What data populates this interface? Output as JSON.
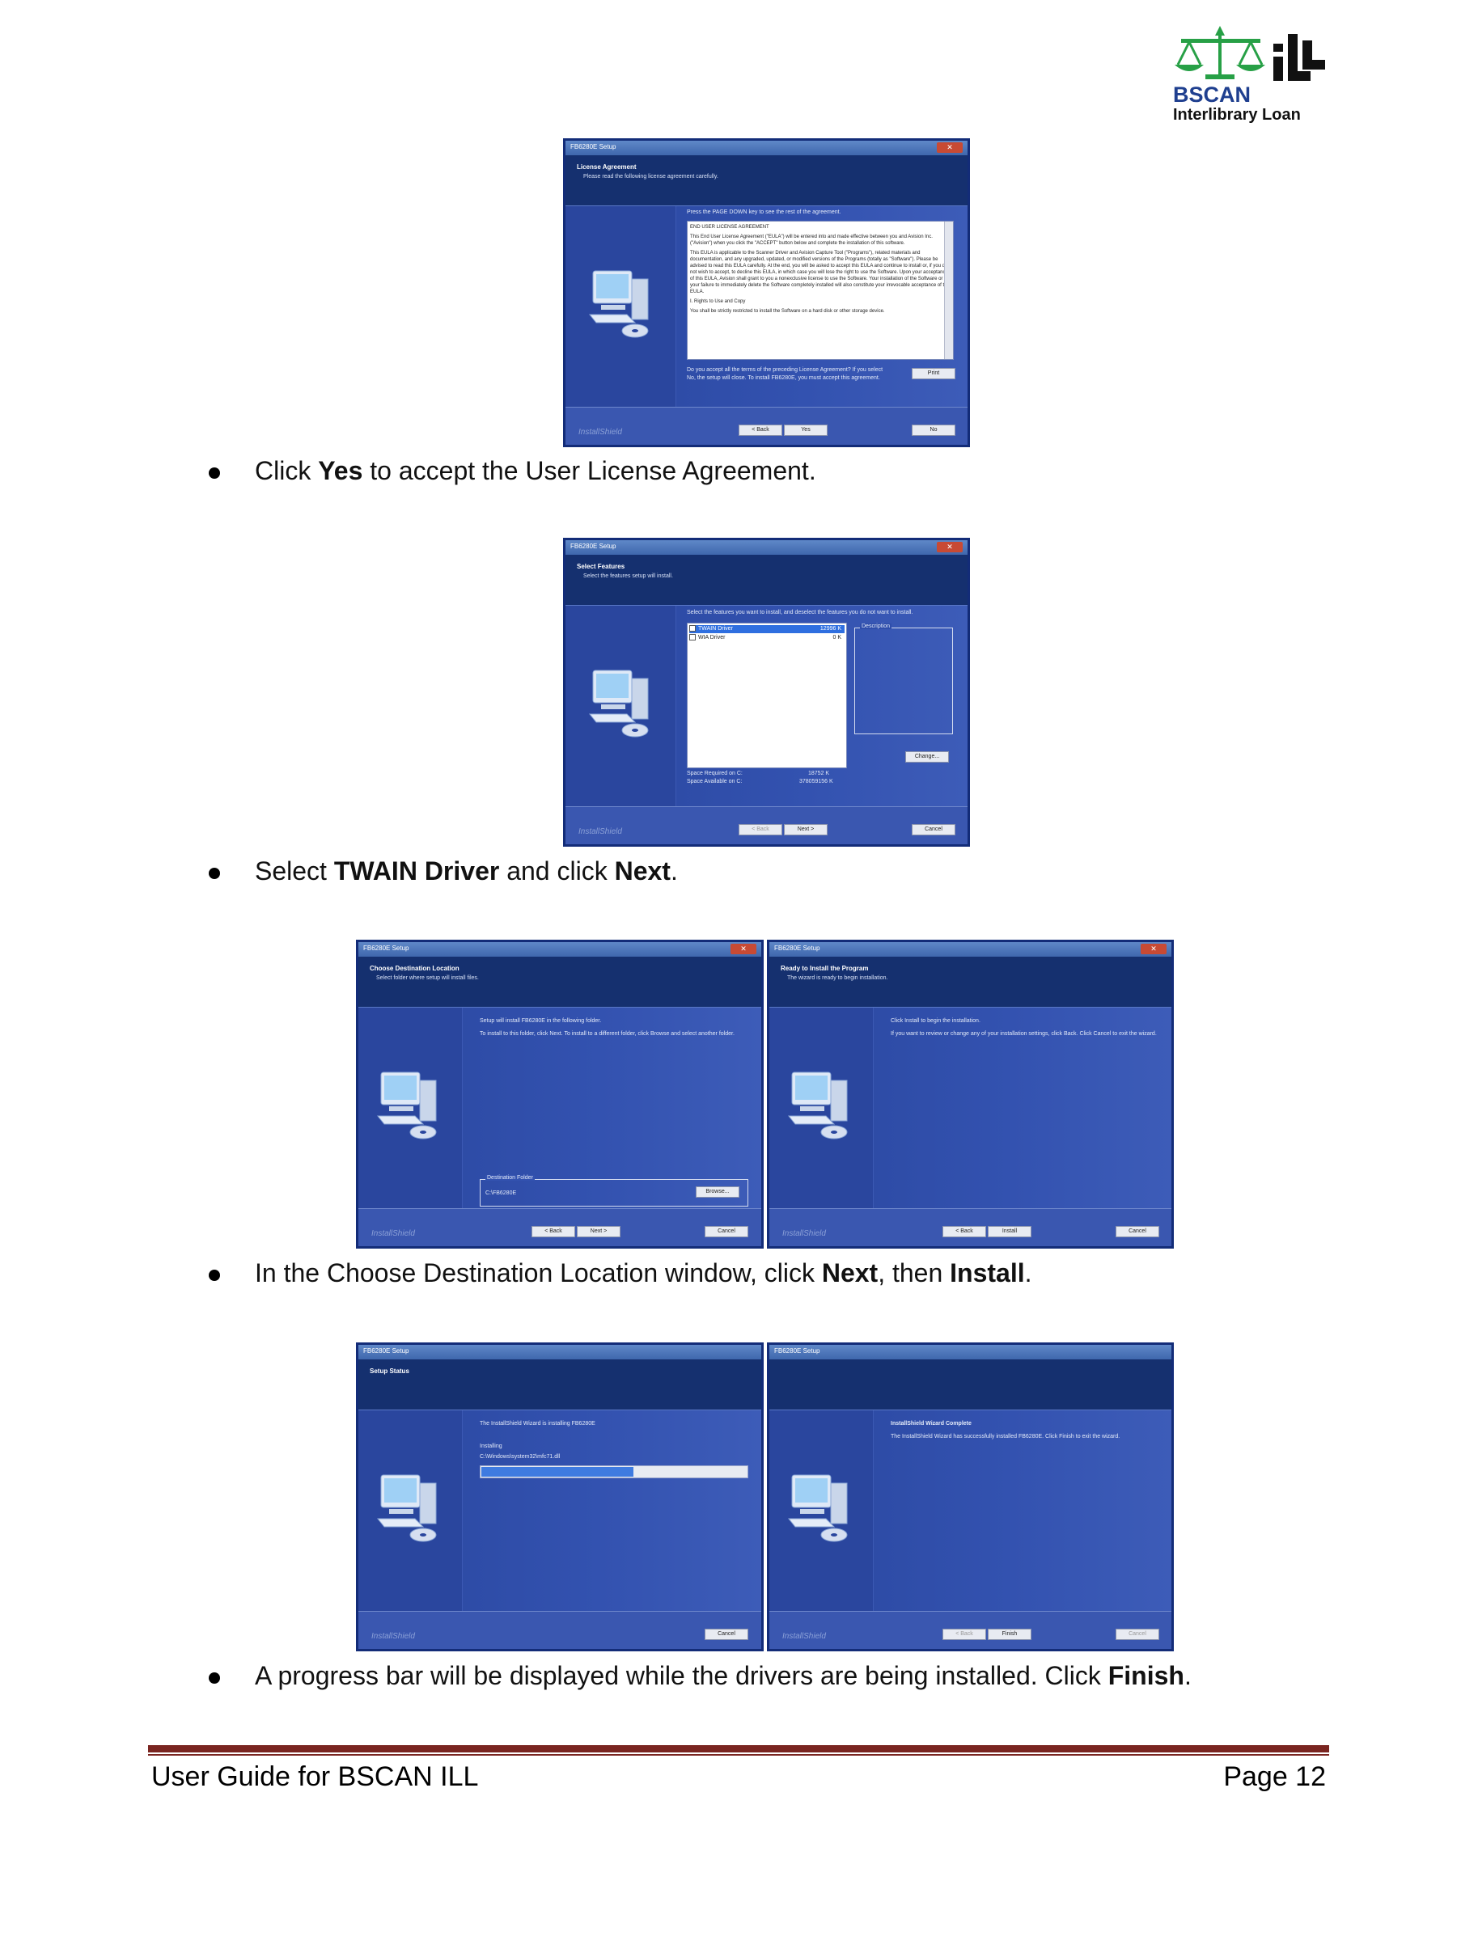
{
  "logo": {
    "brand": "BSCAN",
    "subtitle": "Interlibrary Loan",
    "mark": "ILL"
  },
  "screens": {
    "license": {
      "window_title": "FB6280E Setup",
      "header_title": "License Agreement",
      "header_sub": "Please read the following license agreement carefully.",
      "instruction": "Press the PAGE DOWN key to see the rest of the agreement.",
      "eula_heading": "END USER LICENSE AGREEMENT",
      "eula_p1": "This End User License Agreement (\"EULA\") will be entered into and made effective between you and Avision Inc. (\"Avision\") when you click the \"ACCEPT\" button below and complete the installation of this software.",
      "eula_p2": "This EULA is applicable to the Scanner Driver and Avision Capture Tool (\"Programs\"), related materials and documentation, and any upgraded, updated, or modified versions of the Programs (totally as \"Software\"). Please be advised to read this EULA carefully. At the end, you will be asked to accept this EULA and continue to install or, if you do not wish to accept, to decline this EULA, in which case you will lose the right to use the Software. Upon your acceptance of this EULA, Avision shall grant to you a nonexclusive license to use the Software. Your installation of the Software or your failure to immediately delete the Software completely installed will also constitute your irrevocable acceptance of this EULA.",
      "eula_p3": "I. Rights to Use and Copy",
      "eula_p4": "You shall be strictly restricted to install the Software on a hard disk or other storage device.",
      "question": "Do you accept all the terms of the preceding License Agreement? If you select No, the setup will close. To install FB6280E, you must accept this agreement.",
      "print": "Print",
      "back": "< Back",
      "yes": "Yes",
      "no": "No"
    },
    "features": {
      "window_title": "FB6280E Setup",
      "header_title": "Select Features",
      "header_sub": "Select the features setup will install.",
      "instruction": "Select the features you want to install, and deselect the features you do not want to install.",
      "items": [
        {
          "name": "TWAIN Driver",
          "size": "12996 K",
          "checked": true
        },
        {
          "name": "WIA Driver",
          "size": "0 K",
          "checked": false
        }
      ],
      "description_label": "Description",
      "change": "Change...",
      "space_required": "Space Required on  C:",
      "space_required_val": "18752 K",
      "space_available": "Space Available on  C:",
      "space_available_val": "378059156 K",
      "back": "< Back",
      "next": "Next >",
      "cancel": "Cancel"
    },
    "destination": {
      "window_title": "FB6280E Setup",
      "header_title": "Choose Destination Location",
      "header_sub": "Select folder where setup will install files.",
      "line1": "Setup will install FB6280E in the following folder.",
      "line2": "To install to this folder, click Next. To install to a different folder, click Browse and select another folder.",
      "folder_label": "Destination Folder",
      "folder_path": "C:\\FB6280E",
      "browse": "Browse...",
      "back": "< Back",
      "next": "Next >",
      "cancel": "Cancel"
    },
    "ready": {
      "window_title": "FB6280E Setup",
      "header_title": "Ready to Install the Program",
      "header_sub": "The wizard is ready to begin installation.",
      "line1": "Click Install to begin the installation.",
      "line2": "If you want to review or change any of your installation settings, click Back. Click Cancel to exit the wizard.",
      "back": "< Back",
      "install": "Install",
      "cancel": "Cancel"
    },
    "status": {
      "window_title": "FB6280E Setup",
      "header_title": "Setup Status",
      "line1": "The InstallShield Wizard is installing FB6280E",
      "installing": "Installing",
      "file": "C:\\Windows\\system32\\mfc71.dll",
      "progress": 0.57,
      "cancel": "Cancel"
    },
    "complete": {
      "window_title": "FB6280E Setup",
      "title": "InstallShield Wizard Complete",
      "line1": "The InstallShield Wizard has successfully installed FB6280E.  Click Finish to exit the wizard.",
      "back": "< Back",
      "finish": "Finish",
      "cancel": "Cancel"
    },
    "installshield": "InstallShield"
  },
  "bullets": {
    "b1": {
      "pre": "Click ",
      "bold": "Yes",
      "post": " to accept the User License Agreement."
    },
    "b2": {
      "pre": "Select ",
      "bold1": "TWAIN Driver",
      "mid": " and click ",
      "bold2": "Next",
      "post": "."
    },
    "b3": {
      "pre": "In the Choose Destination Location window, click ",
      "bold1": "Next",
      "mid": ", then ",
      "bold2": "Install",
      "post": "."
    },
    "b4": {
      "pre": "A progress bar will be displayed while the drivers are being installed.  Click ",
      "bold": "Finish",
      "post": "."
    }
  },
  "footer": {
    "left": "User Guide for BSCAN ILL",
    "right": "Page 12"
  }
}
